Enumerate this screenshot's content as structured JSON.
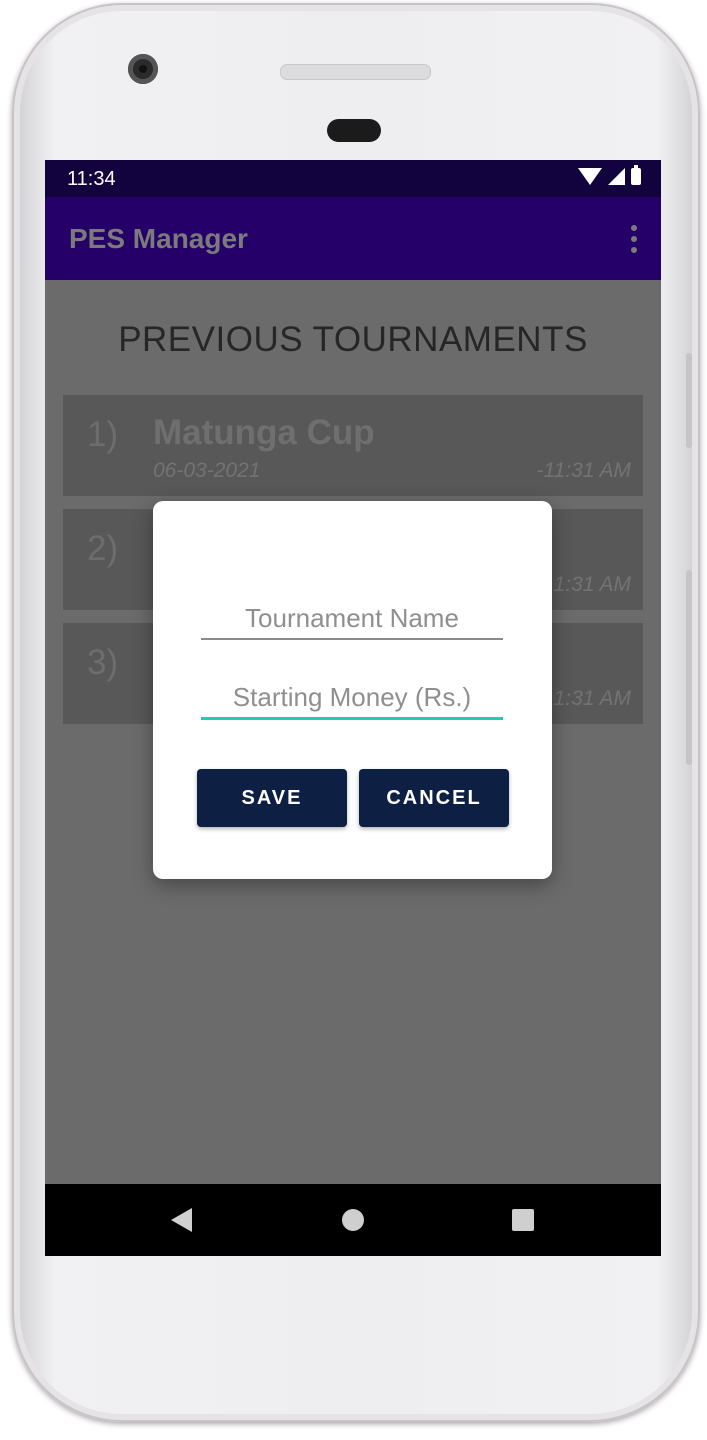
{
  "status_bar": {
    "time": "11:34",
    "icons": [
      "wifi-icon",
      "signal-icon",
      "battery-icon"
    ]
  },
  "app_bar": {
    "title": "PES Manager",
    "overflow_icon": "more-vert-icon"
  },
  "main": {
    "section_title": "PREVIOUS TOURNAMENTS",
    "tournaments": [
      {
        "number": "1)",
        "name": "Matunga Cup",
        "date": "06-03-2021",
        "time": "-11:31 AM"
      },
      {
        "number": "2)",
        "name": "",
        "date": "",
        "time": "1:31 AM"
      },
      {
        "number": "3)",
        "name": "",
        "date": "",
        "time": "1:31 AM"
      }
    ]
  },
  "dialog": {
    "tournament_name": {
      "value": "",
      "placeholder": "Tournament Name"
    },
    "starting_money": {
      "value": "",
      "placeholder": "Starting Money (Rs.)"
    },
    "save_label": "SAVE",
    "cancel_label": "CANCEL"
  },
  "nav_bar": {
    "icons": [
      "back-icon",
      "home-icon",
      "recents-icon"
    ]
  },
  "colors": {
    "status_bar": "#12023d",
    "app_bar": "#260069",
    "scrim_background": "#6b6b6b",
    "button": "#0e1f44",
    "input_focus_underline": "#2ec4b6"
  }
}
